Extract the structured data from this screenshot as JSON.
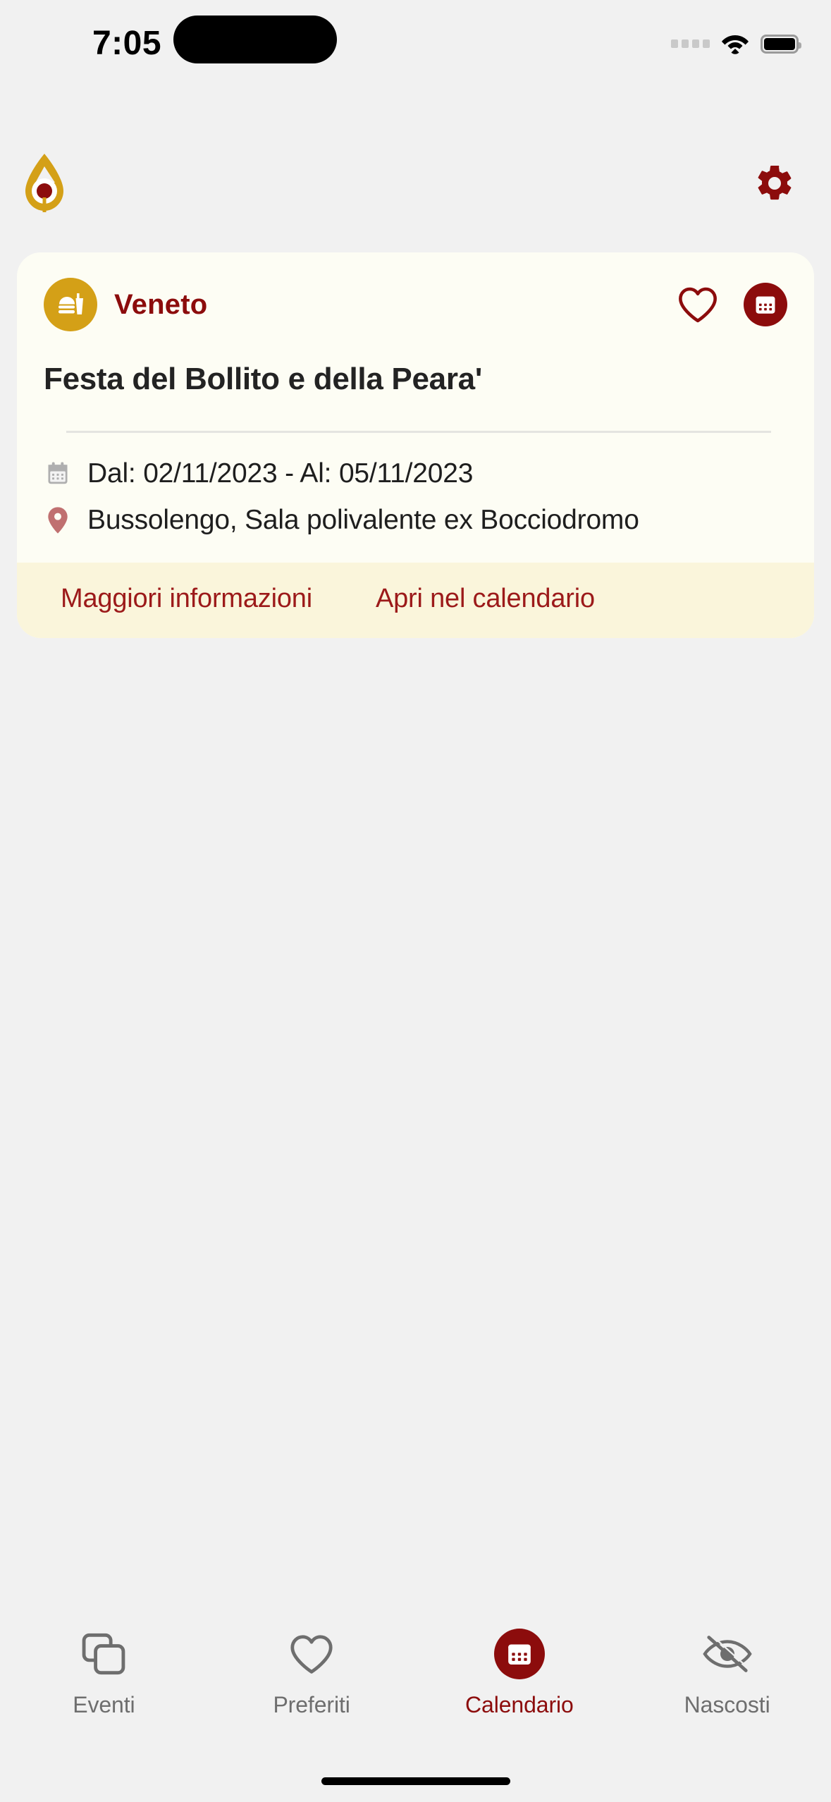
{
  "status_bar": {
    "time": "7:05",
    "signal_icon": "signal-dots-icon",
    "wifi_icon": "wifi-icon",
    "battery_icon": "battery-full-icon"
  },
  "header": {
    "logo_icon": "app-logo-droplet-icon",
    "settings_icon": "gear-icon",
    "colors": {
      "logo_gold": "#D4A017",
      "logo_red": "#8C0C0C",
      "gear_red": "#8C0C0C"
    }
  },
  "event_card": {
    "category": {
      "label": "Veneto",
      "icon": "food-burger-drink-icon",
      "badge_color": "#D4A017",
      "text_color": "#8C0C0C"
    },
    "actions": {
      "favorite_icon": "heart-outline-icon",
      "calendar_icon": "calendar-icon"
    },
    "title": "Festa del Bollito e della Peara'",
    "date_row": {
      "icon": "calendar-icon",
      "text": "Dal: 02/11/2023 - Al: 05/11/2023",
      "from_label": "Dal:",
      "from_date": "02/11/2023",
      "to_label": "Al:",
      "to_date": "05/11/2023"
    },
    "location_row": {
      "icon": "map-pin-icon",
      "text": "Bussolengo, Sala polivalente ex Bocciodromo"
    },
    "footer": {
      "more_info_label": "Maggiori informazioni",
      "open_calendar_label": "Apri nel calendario",
      "background": "#FAF5DB",
      "link_color": "#9C1A1A"
    },
    "background": "#FDFDF4"
  },
  "tabbar": {
    "items": [
      {
        "label": "Eventi",
        "icon": "stacked-cards-icon",
        "active": false
      },
      {
        "label": "Preferiti",
        "icon": "heart-outline-icon",
        "active": false
      },
      {
        "label": "Calendario",
        "icon": "calendar-icon",
        "active": true
      },
      {
        "label": "Nascosti",
        "icon": "eye-slash-icon",
        "active": false
      }
    ],
    "active_color": "#8C0C0C",
    "inactive_color": "#6E6E6E"
  }
}
